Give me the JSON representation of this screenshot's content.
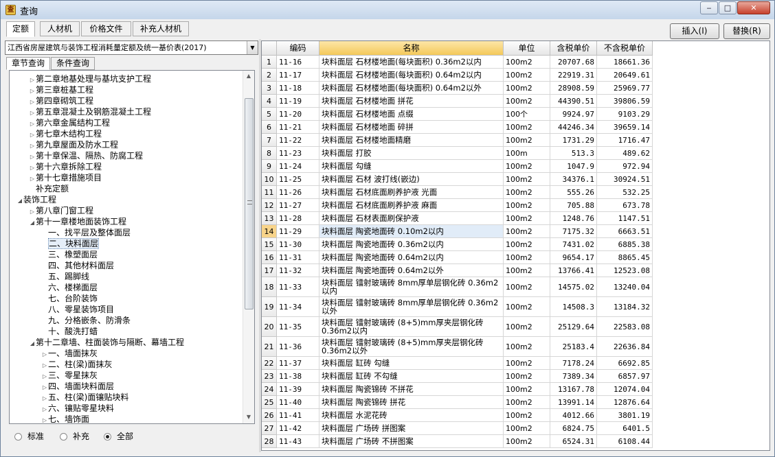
{
  "window": {
    "title": "查询",
    "app_icon_glyph": "查",
    "min": "‒",
    "max": "□",
    "close": "✕"
  },
  "top_tabs": [
    "定额",
    "人材机",
    "价格文件",
    "补充人材机"
  ],
  "action_buttons": {
    "insert": "插入(I)",
    "replace": "替换(R)"
  },
  "library_select": "江西省房屋建筑与装饰工程消耗量定额及统一基价表(2017)",
  "sub_tabs": [
    "章节查询",
    "条件查询"
  ],
  "tree": [
    {
      "label": "第二章地基处理与基坑支护工程",
      "level": 2,
      "arrow": "▷"
    },
    {
      "label": "第三章桩基工程",
      "level": 2,
      "arrow": "▷"
    },
    {
      "label": "第四章砌筑工程",
      "level": 2,
      "arrow": "▷"
    },
    {
      "label": "第五章混凝土及钢筋混凝土工程",
      "level": 2,
      "arrow": "▷"
    },
    {
      "label": "第六章金属结构工程",
      "level": 2,
      "arrow": "▷"
    },
    {
      "label": "第七章木结构工程",
      "level": 2,
      "arrow": "▷"
    },
    {
      "label": "第九章屋面及防水工程",
      "level": 2,
      "arrow": "▷"
    },
    {
      "label": "第十章保温、隔热、防腐工程",
      "level": 2,
      "arrow": "▷"
    },
    {
      "label": "第十六章拆除工程",
      "level": 2,
      "arrow": "▷"
    },
    {
      "label": "第十七章措施项目",
      "level": 2,
      "arrow": "▷"
    },
    {
      "label": "补充定额",
      "level": 2,
      "arrow": ""
    },
    {
      "label": "装饰工程",
      "level": 1,
      "arrow": "◢"
    },
    {
      "label": "第八章门窗工程",
      "level": 2,
      "arrow": "▷"
    },
    {
      "label": "第十一章楼地面装饰工程",
      "level": 2,
      "arrow": "◢"
    },
    {
      "label": "一、找平层及整体面层",
      "level": 3,
      "arrow": ""
    },
    {
      "label": "二、块料面层",
      "level": 3,
      "arrow": "",
      "selected": true
    },
    {
      "label": "三、橡塑面层",
      "level": 3,
      "arrow": ""
    },
    {
      "label": "四、其他材料面层",
      "level": 3,
      "arrow": ""
    },
    {
      "label": "五、踢脚线",
      "level": 3,
      "arrow": ""
    },
    {
      "label": "六、楼梯面层",
      "level": 3,
      "arrow": ""
    },
    {
      "label": "七、台阶装饰",
      "level": 3,
      "arrow": ""
    },
    {
      "label": "八、零星装饰项目",
      "level": 3,
      "arrow": ""
    },
    {
      "label": "九、分格嵌条、防滑条",
      "level": 3,
      "arrow": ""
    },
    {
      "label": "十、酸洗打蜡",
      "level": 3,
      "arrow": ""
    },
    {
      "label": "第十二章墙、柱面装饰与隔断、幕墙工程",
      "level": 2,
      "arrow": "◢"
    },
    {
      "label": "一、墙面抹灰",
      "level": 3,
      "arrow": "▷"
    },
    {
      "label": "二、柱(梁)面抹灰",
      "level": 3,
      "arrow": "▷"
    },
    {
      "label": "三、零星抹灰",
      "level": 3,
      "arrow": "▷"
    },
    {
      "label": "四、墙面块料面层",
      "level": 3,
      "arrow": "▷"
    },
    {
      "label": "五、柱(梁)面镶贴块料",
      "level": 3,
      "arrow": "▷"
    },
    {
      "label": "六、镶贴零星块料",
      "level": 3,
      "arrow": "▷"
    },
    {
      "label": "七、墙饰面",
      "level": 3,
      "arrow": "▷"
    }
  ],
  "filters": {
    "options": [
      "标准",
      "补充",
      "全部"
    ],
    "selected": "全部"
  },
  "table": {
    "headers": [
      "",
      "编码",
      "名称",
      "单位",
      "含税单价",
      "不含税单价"
    ],
    "current_row": 14,
    "rows": [
      {
        "n": "1",
        "code": "11-16",
        "name": "块料面层 石材楼地面(每块面积) 0.36m2以内",
        "unit": "100m2",
        "p1": "20707.68",
        "p2": "18661.36"
      },
      {
        "n": "2",
        "code": "11-17",
        "name": "块料面层 石材楼地面(每块面积) 0.64m2以内",
        "unit": "100m2",
        "p1": "22919.31",
        "p2": "20649.61"
      },
      {
        "n": "3",
        "code": "11-18",
        "name": "块料面层 石材楼地面(每块面积) 0.64m2以外",
        "unit": "100m2",
        "p1": "28908.59",
        "p2": "25969.77"
      },
      {
        "n": "4",
        "code": "11-19",
        "name": "块料面层 石材楼地面 拼花",
        "unit": "100m2",
        "p1": "44390.51",
        "p2": "39806.59"
      },
      {
        "n": "5",
        "code": "11-20",
        "name": "块料面层 石材楼地面 点缀",
        "unit": "100个",
        "p1": "9924.97",
        "p2": "9103.29"
      },
      {
        "n": "6",
        "code": "11-21",
        "name": "块料面层 石材楼地面 碎拼",
        "unit": "100m2",
        "p1": "44246.34",
        "p2": "39659.14"
      },
      {
        "n": "7",
        "code": "11-22",
        "name": "块料面层 石材楼地面精磨",
        "unit": "100m2",
        "p1": "1731.29",
        "p2": "1716.47"
      },
      {
        "n": "8",
        "code": "11-23",
        "name": "块料面层 打胶",
        "unit": "100m",
        "p1": "513.3",
        "p2": "489.62"
      },
      {
        "n": "9",
        "code": "11-24",
        "name": "块料面层 勾缝",
        "unit": "100m2",
        "p1": "1047.9",
        "p2": "972.94"
      },
      {
        "n": "10",
        "code": "11-25",
        "name": "块料面层 石材 波打线(嵌边)",
        "unit": "100m2",
        "p1": "34376.1",
        "p2": "30924.51"
      },
      {
        "n": "11",
        "code": "11-26",
        "name": "块料面层 石材底面刷养护液 光面",
        "unit": "100m2",
        "p1": "555.26",
        "p2": "532.25"
      },
      {
        "n": "12",
        "code": "11-27",
        "name": "块料面层 石材底面刷养护液 麻面",
        "unit": "100m2",
        "p1": "705.88",
        "p2": "673.78"
      },
      {
        "n": "13",
        "code": "11-28",
        "name": "块料面层 石材表面刷保护液",
        "unit": "100m2",
        "p1": "1248.76",
        "p2": "1147.51"
      },
      {
        "n": "14",
        "code": "11-29",
        "name": "块料面层 陶瓷地面砖 0.10m2以内",
        "unit": "100m2",
        "p1": "7175.32",
        "p2": "6663.51"
      },
      {
        "n": "15",
        "code": "11-30",
        "name": "块料面层 陶瓷地面砖 0.36m2以内",
        "unit": "100m2",
        "p1": "7431.02",
        "p2": "6885.38"
      },
      {
        "n": "16",
        "code": "11-31",
        "name": "块料面层 陶瓷地面砖 0.64m2以内",
        "unit": "100m2",
        "p1": "9654.17",
        "p2": "8865.45"
      },
      {
        "n": "17",
        "code": "11-32",
        "name": "块料面层 陶瓷地面砖 0.64m2以外",
        "unit": "100m2",
        "p1": "13766.41",
        "p2": "12523.08"
      },
      {
        "n": "18",
        "code": "11-33",
        "name": "块料面层 镭射玻璃砖 8mm厚单层钢化砖 0.36m2以内",
        "unit": "100m2",
        "p1": "14575.02",
        "p2": "13240.04",
        "tall": true
      },
      {
        "n": "19",
        "code": "11-34",
        "name": "块料面层 镭射玻璃砖 8mm厚单层钢化砖 0.36m2以外",
        "unit": "100m2",
        "p1": "14508.3",
        "p2": "13184.32",
        "tall": true
      },
      {
        "n": "20",
        "code": "11-35",
        "name": "块料面层 镭射玻璃砖 (8+5)mm厚夹层钢化砖 0.36m2以内",
        "unit": "100m2",
        "p1": "25129.64",
        "p2": "22583.08",
        "tall": true
      },
      {
        "n": "21",
        "code": "11-36",
        "name": "块料面层 镭射玻璃砖 (8+5)mm厚夹层钢化砖 0.36m2以外",
        "unit": "100m2",
        "p1": "25183.4",
        "p2": "22636.84",
        "tall": true
      },
      {
        "n": "22",
        "code": "11-37",
        "name": "块料面层 缸砖 勾缝",
        "unit": "100m2",
        "p1": "7178.24",
        "p2": "6692.85"
      },
      {
        "n": "23",
        "code": "11-38",
        "name": "块料面层 缸砖 不勾缝",
        "unit": "100m2",
        "p1": "7389.34",
        "p2": "6857.97"
      },
      {
        "n": "24",
        "code": "11-39",
        "name": "块料面层 陶瓷锦砖 不拼花",
        "unit": "100m2",
        "p1": "13167.78",
        "p2": "12074.04"
      },
      {
        "n": "25",
        "code": "11-40",
        "name": "块料面层 陶瓷锦砖 拼花",
        "unit": "100m2",
        "p1": "13991.14",
        "p2": "12876.64"
      },
      {
        "n": "26",
        "code": "11-41",
        "name": "块料面层 水泥花砖",
        "unit": "100m2",
        "p1": "4012.66",
        "p2": "3801.19"
      },
      {
        "n": "27",
        "code": "11-42",
        "name": "块料面层 广场砖 拼图案",
        "unit": "100m2",
        "p1": "6824.75",
        "p2": "6401.5"
      },
      {
        "n": "28",
        "code": "11-43",
        "name": "块料面层 广场砖 不拼图案",
        "unit": "100m2",
        "p1": "6524.31",
        "p2": "6108.44"
      }
    ]
  }
}
